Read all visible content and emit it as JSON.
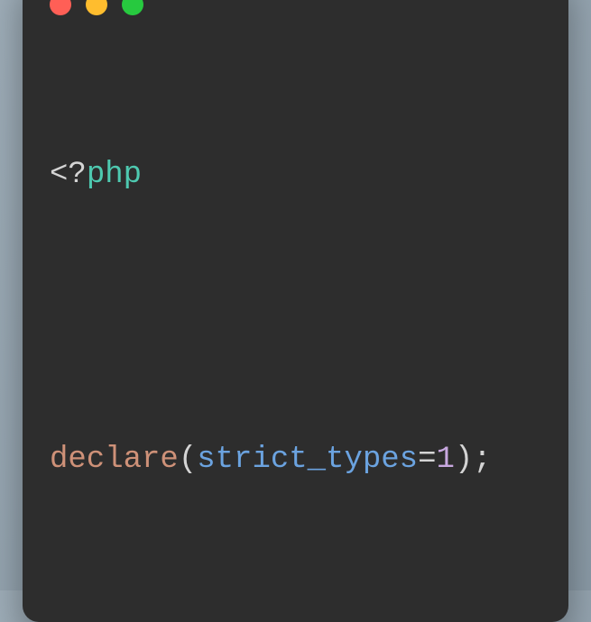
{
  "window": {
    "traffic_lights": {
      "red": "#ff5f56",
      "yellow": "#ffbd2e",
      "green": "#27c93f"
    }
  },
  "code": {
    "line1": {
      "open_angle": "<?",
      "php": "php"
    },
    "line2": {
      "declare": "declare",
      "paren_open": "(",
      "ident": "strict_types",
      "eq": "=",
      "num": "1",
      "paren_close": ")",
      "semi": ";"
    }
  }
}
